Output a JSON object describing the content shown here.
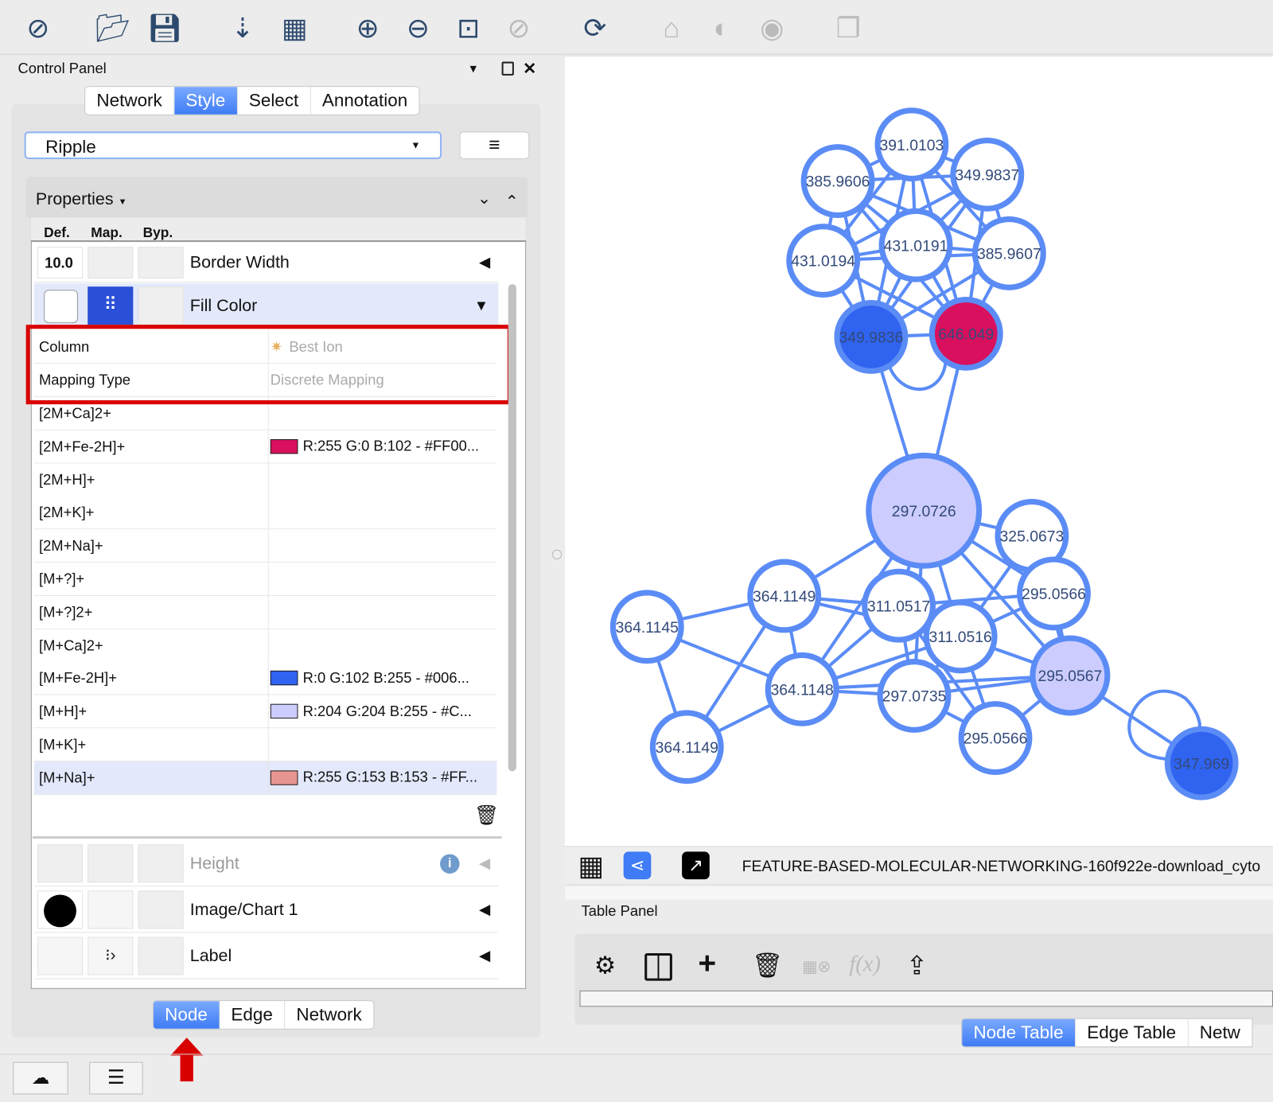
{
  "toolbar": {
    "icons": [
      "cytoscape-logo-icon",
      "open-folder-icon",
      "save-icon",
      "import-network-icon",
      "import-table-icon",
      "zoom-in-icon",
      "zoom-out-icon",
      "zoom-fit-icon",
      "zoom-selected-icon",
      "refresh-icon",
      "home-icon",
      "hide-icon",
      "show-icon",
      "export-icon"
    ]
  },
  "control_panel": {
    "title": "Control Panel",
    "tabs": [
      "Network",
      "Style",
      "Select",
      "Annotation"
    ],
    "active_tab": "Style",
    "style_select": "Ripple",
    "properties_label": "Properties",
    "col_headers": [
      "Def.",
      "Map.",
      "Byp."
    ],
    "border_width": {
      "def": "10.0",
      "label": "Border Width"
    },
    "fill_color": {
      "label": "Fill Color",
      "column_label": "Column",
      "column_value": "Best Ion",
      "mapping_label": "Mapping Type",
      "mapping_value": "Discrete Mapping",
      "mappings": [
        {
          "key": "[2M+Ca]2+",
          "value": "",
          "color": ""
        },
        {
          "key": "[2M+Fe-2H]+",
          "value": "R:255 G:0 B:102 - #FF00...",
          "color": "#d8105e"
        },
        {
          "key": "[2M+H]+",
          "value": "",
          "color": ""
        },
        {
          "key": "[2M+K]+",
          "value": "",
          "color": ""
        },
        {
          "key": "[2M+Na]+",
          "value": "",
          "color": ""
        },
        {
          "key": "[M+?]+",
          "value": "",
          "color": ""
        },
        {
          "key": "[M+?]2+",
          "value": "",
          "color": ""
        },
        {
          "key": "[M+Ca]2+",
          "value": "",
          "color": ""
        },
        {
          "key": "[M+Fe-2H]+",
          "value": "R:0 G:102 B:255 - #006...",
          "color": "#2f63f0"
        },
        {
          "key": "[M+H]+",
          "value": "R:204 G:204 B:255 - #C...",
          "color": "#ccccff"
        },
        {
          "key": "[M+K]+",
          "value": "",
          "color": ""
        },
        {
          "key": "[M+Na]+",
          "value": "R:255 G:153 B:153 - #FF...",
          "color": "#e8958f"
        }
      ]
    },
    "height_label": "Height",
    "image_chart_label": "Image/Chart 1",
    "label_label": "Label",
    "bottom_tabs": [
      "Node",
      "Edge",
      "Network"
    ],
    "active_bottom_tab": "Node"
  },
  "network": {
    "title": "FEATURE-BASED-MOLECULAR-NETWORKING-160f922e-download_cyto",
    "border_color": "#5b8cf6",
    "nodes": [
      {
        "label": "391.0103",
        "fill": "#ffffff"
      },
      {
        "label": "385.9606",
        "fill": "#ffffff"
      },
      {
        "label": "349.9837",
        "fill": "#ffffff"
      },
      {
        "label": "431.0191",
        "fill": "#ffffff"
      },
      {
        "label": "431.0194",
        "fill": "#ffffff"
      },
      {
        "label": "385.9607",
        "fill": "#ffffff"
      },
      {
        "label": "349.9836",
        "fill": "#2f63f0"
      },
      {
        "label": "646.049",
        "fill": "#d8105e"
      },
      {
        "label": "297.0726",
        "fill": "#ccccff"
      },
      {
        "label": "325.0673",
        "fill": "#ffffff"
      },
      {
        "label": "364.1149",
        "fill": "#ffffff"
      },
      {
        "label": "295.0566",
        "fill": "#ffffff"
      },
      {
        "label": "311.0517",
        "fill": "#ffffff"
      },
      {
        "label": "364.1145",
        "fill": "#ffffff"
      },
      {
        "label": "311.0516",
        "fill": "#ffffff"
      },
      {
        "label": "295.0567",
        "fill": "#ccccff"
      },
      {
        "label": "364.1148",
        "fill": "#ffffff"
      },
      {
        "label": "297.0735",
        "fill": "#ffffff"
      },
      {
        "label": "295.0566",
        "fill": "#ffffff"
      },
      {
        "label": "364.1149",
        "fill": "#ffffff"
      },
      {
        "label": "347.969",
        "fill": "#2f63f0"
      }
    ],
    "edges": [
      [
        0,
        1
      ],
      [
        0,
        2
      ],
      [
        0,
        3
      ],
      [
        0,
        4
      ],
      [
        0,
        5
      ],
      [
        0,
        6
      ],
      [
        0,
        7
      ],
      [
        1,
        2
      ],
      [
        1,
        3
      ],
      [
        1,
        4
      ],
      [
        1,
        5
      ],
      [
        1,
        6
      ],
      [
        1,
        7
      ],
      [
        2,
        3
      ],
      [
        2,
        4
      ],
      [
        2,
        5
      ],
      [
        2,
        6
      ],
      [
        2,
        7
      ],
      [
        3,
        4
      ],
      [
        3,
        5
      ],
      [
        3,
        6
      ],
      [
        3,
        7
      ],
      [
        4,
        5
      ],
      [
        4,
        6
      ],
      [
        4,
        7
      ],
      [
        5,
        6
      ],
      [
        5,
        7
      ],
      [
        6,
        7
      ],
      [
        6,
        8
      ],
      [
        7,
        8
      ],
      [
        8,
        9
      ],
      [
        8,
        10
      ],
      [
        8,
        12
      ],
      [
        8,
        14
      ],
      [
        8,
        11
      ],
      [
        8,
        15
      ],
      [
        8,
        16
      ],
      [
        8,
        17
      ],
      [
        9,
        11
      ],
      [
        9,
        15
      ],
      [
        9,
        14
      ],
      [
        10,
        13
      ],
      [
        10,
        12
      ],
      [
        10,
        16
      ],
      [
        10,
        14
      ],
      [
        10,
        19
      ],
      [
        13,
        16
      ],
      [
        13,
        19
      ],
      [
        19,
        16
      ],
      [
        12,
        14
      ],
      [
        12,
        16
      ],
      [
        12,
        17
      ],
      [
        12,
        11
      ],
      [
        14,
        11
      ],
      [
        14,
        15
      ],
      [
        14,
        17
      ],
      [
        14,
        18
      ],
      [
        14,
        16
      ],
      [
        15,
        17
      ],
      [
        15,
        18
      ],
      [
        15,
        11
      ],
      [
        15,
        20
      ],
      [
        16,
        17
      ],
      [
        16,
        15
      ],
      [
        17,
        18
      ],
      [
        12,
        18
      ]
    ],
    "self_loops": [
      20
    ]
  },
  "table_panel": {
    "title": "Table Panel",
    "tabs": [
      "Node Table",
      "Edge Table",
      "Netw"
    ],
    "active_tab": "Node Table"
  }
}
